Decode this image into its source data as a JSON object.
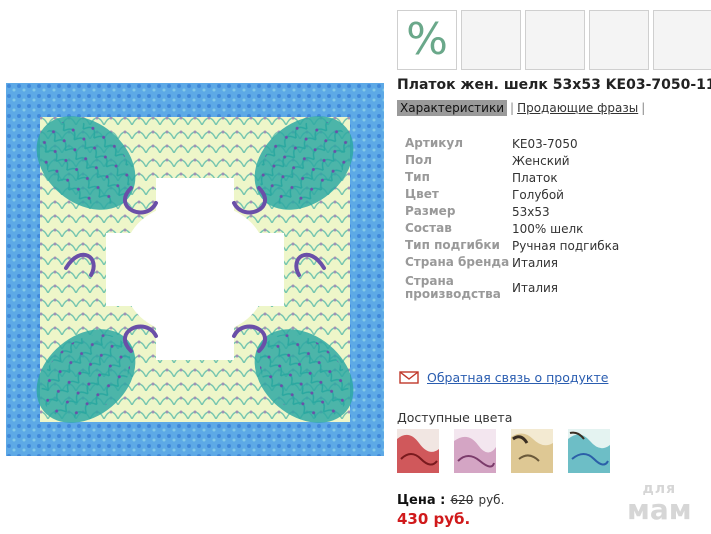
{
  "thumbnails": [
    {
      "kind": "discount",
      "symbol": "%"
    },
    {
      "kind": "empty"
    },
    {
      "kind": "empty"
    },
    {
      "kind": "empty"
    },
    {
      "kind": "empty"
    }
  ],
  "product": {
    "title": "Платок жен. шелк 53x53 KE03-7050-11"
  },
  "tabs": [
    {
      "label": "Характеристики",
      "active": true
    },
    {
      "label": "Продающие фразы",
      "active": false
    }
  ],
  "tab_separator": "|",
  "specs": [
    {
      "key": "Артикул",
      "value": "KE03-7050"
    },
    {
      "key": "Пол",
      "value": "Женский"
    },
    {
      "key": "Тип",
      "value": "Платок"
    },
    {
      "key": "Цвет",
      "value": "Голубой"
    },
    {
      "key": "Размер",
      "value": "53x53"
    },
    {
      "key": "Состав",
      "value": "100% шелк"
    },
    {
      "key": "Тип подгибки",
      "value": "Ручная подгибка"
    },
    {
      "key": "Страна бренда",
      "value": "Италия"
    },
    {
      "key": "Страна производства",
      "value": "Италия"
    }
  ],
  "feedback": {
    "icon": "envelope-icon",
    "label": "Обратная связь о продукте"
  },
  "colors": {
    "label": "Доступные цвета",
    "swatches": [
      {
        "name": "red",
        "color": "#c8353a",
        "selected": false
      },
      {
        "name": "pink",
        "color": "#c98fb6",
        "selected": false
      },
      {
        "name": "beige",
        "color": "#d9c28a",
        "selected": false
      },
      {
        "name": "blue",
        "color": "#4fb0bb",
        "selected": true
      }
    ]
  },
  "price": {
    "label": "Цена :",
    "old": "620",
    "currency": "руб.",
    "new": "430 руб."
  },
  "watermark": {
    "line1": "для",
    "line2": "мам"
  },
  "accent_colors": {
    "price_red": "#d0191b",
    "link_blue": "#2a5db0",
    "scarf_blue": "#3f8fd6"
  }
}
